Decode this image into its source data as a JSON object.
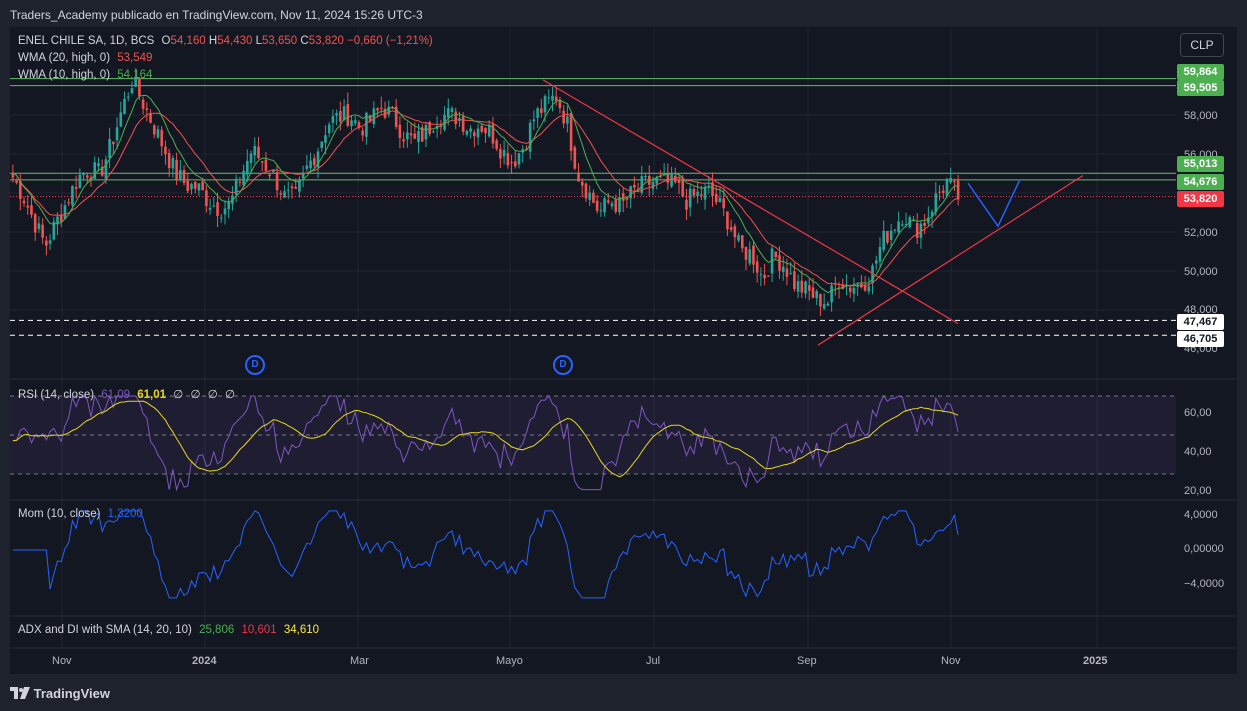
{
  "header": {
    "title": "Traders_Academy publicado en TradingView.com, Nov 11, 2024 15:26 UTC-3"
  },
  "footer": {
    "brand": "TradingView"
  },
  "currency_button": "CLP",
  "colors": {
    "up": "#26a69a",
    "down": "#ef5350",
    "wma20": "#ef5350",
    "wma10": "#4caf50",
    "rsi": "#7e57c2",
    "rsi_ma": "#e6d61f",
    "mom": "#2962ff",
    "hline": "#66bb6a",
    "trend": "#f23645"
  },
  "legend": {
    "main": {
      "symbol": "ENEL CHILE SA, 1D, BCS",
      "o_label": "O",
      "o": "54,160",
      "h_label": "H",
      "h": "54,430",
      "l_label": "L",
      "l": "53,650",
      "c_label": "C",
      "c": "53,820",
      "change": "−0,660 (−1,21%)"
    },
    "wma20": {
      "label": "WMA (20, high, 0)",
      "value": "53,549"
    },
    "wma10": {
      "label": "WMA (10, high, 0)",
      "value": "54,164"
    },
    "rsi": {
      "label": "RSI (14, close)",
      "v1": "61,09",
      "v2": "61,01",
      "v3": "∅",
      "v4": "∅",
      "v5": "∅",
      "v6": "∅"
    },
    "mom": {
      "label": "Mom (10, close)",
      "value": "1,3200"
    },
    "adx": {
      "label": "ADX and DI with SMA (14, 20, 10)",
      "v1": "25,806",
      "v2": "10,601",
      "v3": "34,610"
    }
  },
  "price_labels": [
    "59,864",
    "59,505",
    "55,013",
    "54,676",
    "53,820",
    "47,467",
    "46,705"
  ],
  "price_ticks": [
    "58,000",
    "56,000",
    "52,000",
    "50,000",
    "48,000",
    "46,000"
  ],
  "rsi_ticks": [
    "60,00",
    "40,00",
    "20,00"
  ],
  "mom_ticks": [
    "4,0000",
    "0,00000",
    "−4,0000"
  ],
  "x_ticks": [
    "Nov",
    "2024",
    "Mar",
    "Mayo",
    "Jul",
    "Sep",
    "Nov",
    "2025"
  ],
  "dividend_marker": "D",
  "chart_data": {
    "type": "candlestick",
    "title": "ENEL CHILE SA, 1D, BCS",
    "ylim": [
      46000,
      60800
    ],
    "x_labels": [
      "Nov",
      "2024",
      "Mar",
      "Mayo",
      "Jul",
      "Sep",
      "Nov",
      "2025"
    ],
    "close_path": [
      54.8,
      53.8,
      52.5,
      51.3,
      52.5,
      53.6,
      54.8,
      55.2,
      55.0,
      56.4,
      58.2,
      59.8,
      58.6,
      57.4,
      56.2,
      55.0,
      54.4,
      54.3,
      53.6,
      53.2,
      53.4,
      54.9,
      56.2,
      55.6,
      54.9,
      53.8,
      53.7,
      55.2,
      56.2,
      57.6,
      57.9,
      58.0,
      57.3,
      57.8,
      58.4,
      57.9,
      57.0,
      56.6,
      57.1,
      57.9,
      58.0,
      57.9,
      57.3,
      57.5,
      57.1,
      56.2,
      55.6,
      56.4,
      57.9,
      58.5,
      59.0,
      57.6,
      55.0,
      54.0,
      53.0,
      53.6,
      53.3,
      54.0,
      54.4,
      54.6,
      54.5,
      54.4,
      53.6,
      53.9,
      54.1,
      53.4,
      52.4,
      51.0,
      50.9,
      49.6,
      50.8,
      50.3,
      49.3,
      49.0,
      48.6,
      48.4,
      49.6,
      49.2,
      49.3,
      49.8,
      51.5,
      52.3,
      53.0,
      52.1,
      52.6,
      53.8,
      54.6,
      53.8
    ],
    "horizontal_levels": [
      59864,
      59505,
      55013,
      54676,
      53820,
      47467,
      46705
    ],
    "wma20_last": 53549,
    "wma10_last": 54164,
    "rsi": {
      "last": 61.09,
      "ma_last": 61.01,
      "ylim": [
        20,
        75
      ],
      "bands": [
        70,
        50,
        30
      ]
    },
    "momentum": {
      "last": 1.32,
      "ylim": [
        -6,
        5
      ]
    },
    "adx": {
      "adx": 25.806,
      "di": 10.601,
      "sma": 34.61
    }
  }
}
